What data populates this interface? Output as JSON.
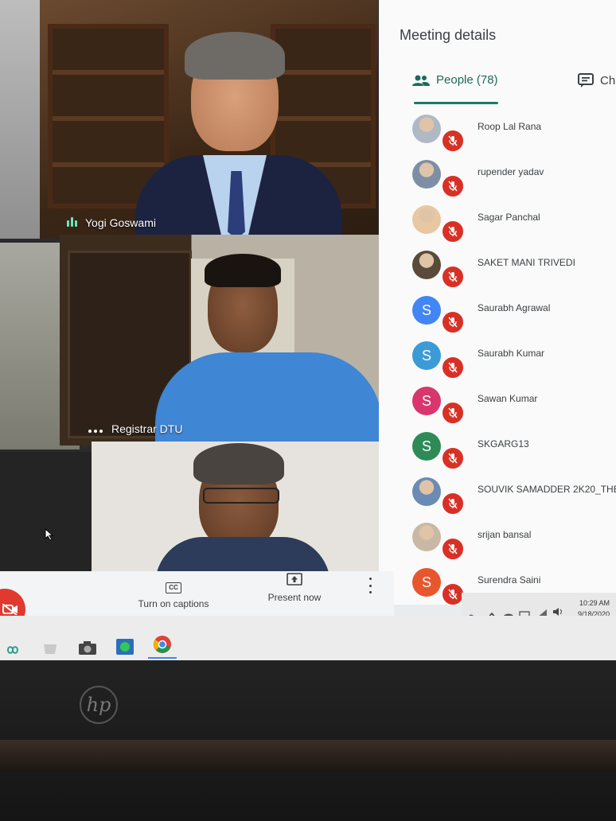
{
  "video": {
    "tiles": [
      {
        "name": "Yogi Goswami",
        "speaking": true
      },
      {
        "name": "Registrar DTU",
        "speaking": false
      },
      {
        "name": "",
        "speaking": false
      }
    ]
  },
  "panel": {
    "title": "Meeting details",
    "tabs": [
      {
        "label": "People (78)",
        "icon": "people-icon",
        "active": true
      },
      {
        "label": "Ch",
        "icon": "chat-icon",
        "active": false
      }
    ],
    "participants": [
      {
        "name": "Roop Lal Rana",
        "avatar": "photo",
        "color": "#b0b8c4",
        "muted": true
      },
      {
        "name": "rupender yadav",
        "avatar": "photo",
        "color": "#7d8ea6",
        "muted": true
      },
      {
        "name": "Sagar Panchal",
        "avatar": "photo",
        "color": "#e8c7a3",
        "muted": true
      },
      {
        "name": "SAKET MANI TRIVEDI",
        "avatar": "photo",
        "color": "#5a4a3a",
        "muted": true
      },
      {
        "name": "Saurabh Agrawal",
        "avatar": "S",
        "color": "#4285f4",
        "muted": true
      },
      {
        "name": "Saurabh Kumar",
        "avatar": "S",
        "color": "#3c9bd6",
        "muted": true
      },
      {
        "name": "Sawan Kumar",
        "avatar": "S",
        "color": "#d9366e",
        "muted": true
      },
      {
        "name": "SKGARG13",
        "avatar": "S",
        "color": "#2e8b57",
        "muted": true
      },
      {
        "name": "SOUVIK SAMADDER 2K20_THE_",
        "avatar": "photo",
        "color": "#6b8bb5",
        "muted": true
      },
      {
        "name": "srijan bansal",
        "avatar": "photo",
        "color": "#c9b8a5",
        "muted": true
      },
      {
        "name": "Surendra Saini",
        "avatar": "S",
        "color": "#e8562e",
        "muted": true
      }
    ]
  },
  "controls": {
    "captions_label": "Turn on captions",
    "present_label": "Present now",
    "cc_glyph": "CC"
  },
  "tray": {
    "time": "10:29 AM",
    "date": "9/18/2020"
  },
  "bezel": {
    "logo": "hp"
  },
  "colors": {
    "accent": "#1e7a63",
    "mute_red": "#d93025",
    "end_call_red": "#e03a2f"
  }
}
